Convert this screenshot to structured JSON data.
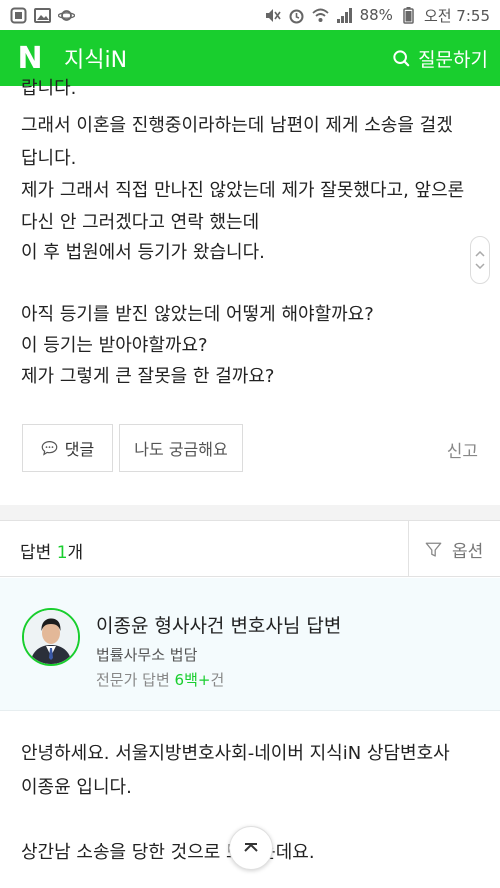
{
  "status_bar": {
    "battery_percent": "88%",
    "time": "오전 7:55",
    "left_icons": [
      "app-icon",
      "gallery-icon",
      "planet-icon"
    ],
    "right_icons": [
      "mute-icon",
      "alarm-icon",
      "wifi-icon",
      "signal-icon",
      "battery-icon"
    ]
  },
  "header": {
    "logo": "N",
    "title": "지식iN",
    "ask_label": "질문하기",
    "brand_color": "#19ce2e"
  },
  "question": {
    "lines": [
      "랍니다.",
      "그래서 이혼을 진행중이라하는데 남편이 제게 소송을 걸겠",
      "답니다.",
      "제가 그래서 직접 만나진 않았는데 제가 잘못했다고, 앞으론",
      "다신 안 그러겠다고 연락 했는데",
      "이 후 법원에서 등기가 왔습니다.",
      "",
      "아직 등기를 받진 않았는데 어떻게 해야할까요?",
      "이 등기는 받아야할까요?",
      "제가 그렇게 큰 잘못을 한 걸까요?"
    ]
  },
  "actions": {
    "comment_label": "댓글",
    "curious_label": "나도 궁금해요",
    "report_label": "신고"
  },
  "answers_header": {
    "title_prefix": "답변 ",
    "count": "1",
    "title_suffix": "개",
    "options_label": "옵션"
  },
  "answerer": {
    "name": "이종윤 형사사건 변호사님 답변",
    "organization": "법률사무소 법담",
    "expert_prefix": "전문가 답변 ",
    "expert_count": "6백+",
    "expert_suffix": "건"
  },
  "answer": {
    "lines": [
      "안녕하세요. 서울지방변호사회-네이버 지식iN 상담변호사",
      "이종윤 입니다.",
      "",
      "상간남 소송을 당한 것으로 보이는데요."
    ]
  }
}
